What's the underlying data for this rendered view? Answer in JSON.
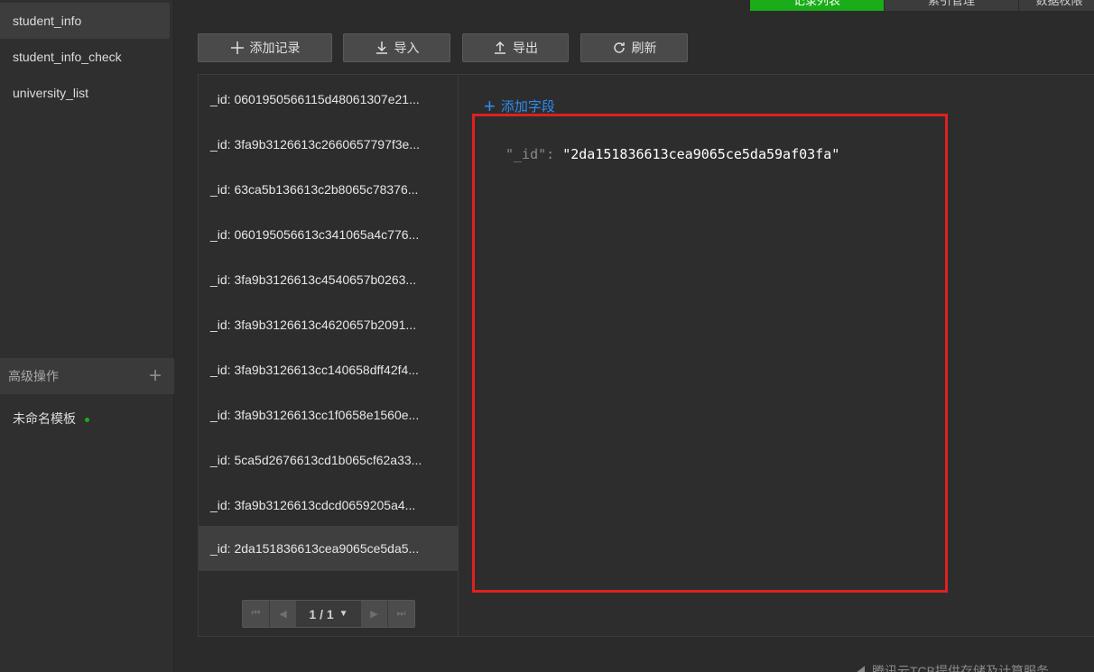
{
  "tabs": [
    {
      "label": "记录列表",
      "width": 149
    },
    {
      "label": "索引管理",
      "width": 149
    },
    {
      "label": "数据权限",
      "width": 90
    }
  ],
  "collections": [
    "student_info",
    "student_info_check",
    "university_list"
  ],
  "advanced": {
    "title": "高级操作",
    "template": "未命名模板"
  },
  "toolbar": {
    "add": "添加记录",
    "import": "导入",
    "export": "导出",
    "refresh": "刷新"
  },
  "records": [
    "_id: 0601950566115d48061307e21...",
    "_id: 3fa9b3126613c2660657797f3e...",
    "_id: 63ca5b136613c2b8065c78376...",
    "_id: 060195056613c341065a4c776...",
    "_id: 3fa9b3126613c4540657b0263...",
    "_id: 3fa9b3126613c4620657b2091...",
    "_id: 3fa9b3126613cc140658dff42f4...",
    "_id: 3fa9b3126613cc1f0658e1560e...",
    "_id: 5ca5d2676613cd1b065cf62a33...",
    "_id: 3fa9b3126613cdcd0659205a4...",
    "_id: 2da151836613cea9065ce5da5..."
  ],
  "pagination": {
    "label": "1 / 1"
  },
  "detail": {
    "add_field": "添加字段",
    "key": "\"_id\":",
    "value": "\"2da151836613cea9065ce5da59af03fa\""
  },
  "footer": "腾讯云TCB提供存储及计算服务"
}
